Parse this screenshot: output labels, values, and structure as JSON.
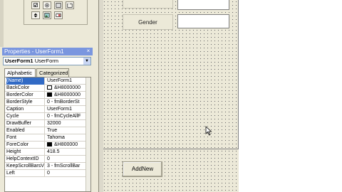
{
  "toolbox": {
    "tools": [
      "checkbox-tool-icon",
      "option-button-tool-icon",
      "toggle-button-tool-icon",
      "frame-tool-icon",
      "spin-button-tool-icon",
      "image-tool-icon",
      "refedit-tool-icon"
    ]
  },
  "properties": {
    "title": "Properties - UserForm1",
    "close": "×",
    "object_name": "UserForm1",
    "object_type": "UserForm",
    "tabs": [
      "Alphabetic",
      "Categorized"
    ],
    "rows": [
      {
        "name": "(Name)",
        "value": "UserForm1"
      },
      {
        "name": "BackColor",
        "value": "&H8000000"
      },
      {
        "name": "BorderColor",
        "value": "&H8000000"
      },
      {
        "name": "BorderStyle",
        "value": "0 - fmBorderSt"
      },
      {
        "name": "Caption",
        "value": "UserForm1"
      },
      {
        "name": "Cycle",
        "value": "0 - fmCycleAllF"
      },
      {
        "name": "DrawBuffer",
        "value": "32000"
      },
      {
        "name": "Enabled",
        "value": "True"
      },
      {
        "name": "Font",
        "value": "Tahoma"
      },
      {
        "name": "ForeColor",
        "value": "&H800000"
      },
      {
        "name": "Height",
        "value": "418.5"
      },
      {
        "name": "HelpContextID",
        "value": "0"
      },
      {
        "name": "KeepScrollBarsV",
        "value": "3 - fmScrollBar"
      },
      {
        "name": "Left",
        "value": "0"
      }
    ],
    "swatch_colors": {
      "BackColor": "#ffffff",
      "BorderColor": "#000000",
      "ForeColor": "#000000"
    }
  },
  "form": {
    "gender_label": "Gender",
    "add_button": "AddNew"
  }
}
